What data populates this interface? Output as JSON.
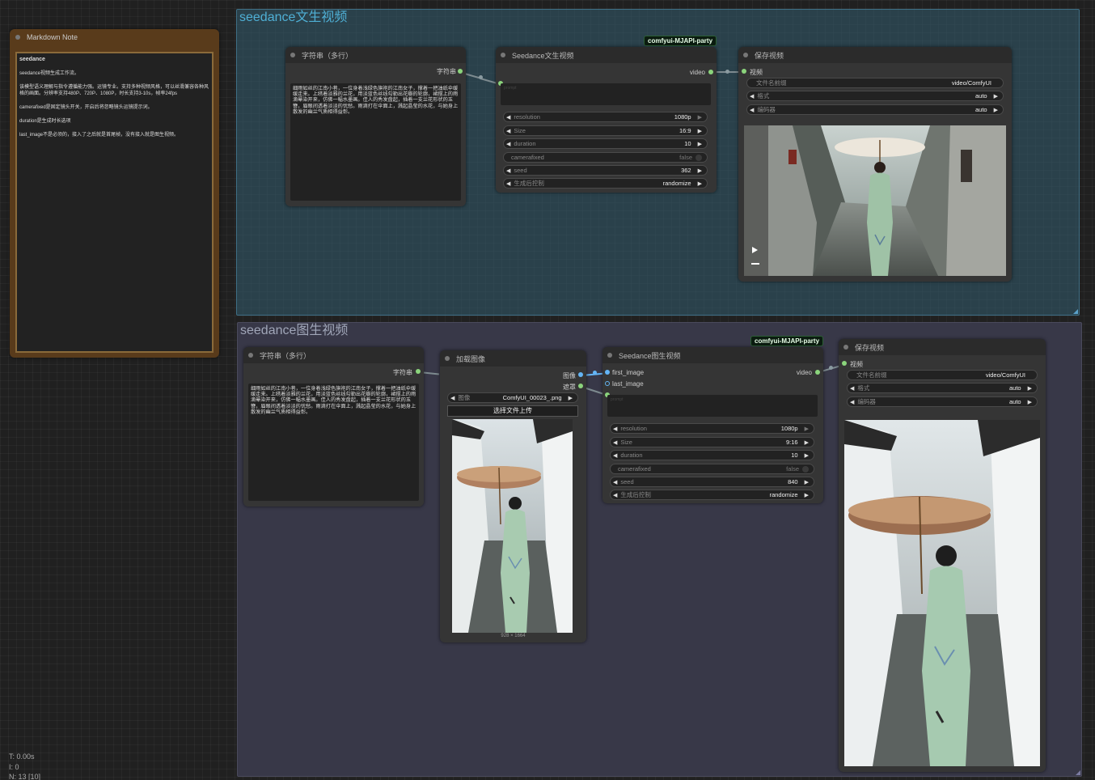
{
  "markdown_note": {
    "title": "Markdown Note",
    "heading": "seedance",
    "paragraphs": [
      "seedance视频生成工作流。",
      "该模型语义理解与指令遵循能力强。运镜专业。支持多种视频风格，可以丝滑兼容各种风格的画面。分辨率支持480P、720P、1080P，时长支持3-10s，帧率24fps",
      "camerafixed是固定镜头开关，开启后将忽略镜头运镜提示词。",
      "duration是生成时长选项",
      "last_image不是必须的，接入了之后就是首尾帧，没有接入就是图生视频。"
    ]
  },
  "groups": {
    "t2v": "seedance文生视频",
    "i2v": "seedance图生视频"
  },
  "badge": "comfyui-MJAPI-party",
  "prompt_text": "细雨如丝的江南小巷，一位身着浅绿色旗袍的江南女子，撑着一把油纸伞缓缓走来。上绣着淡雅的兰花，用淡蓝色丝线勾勒出花瓣的轮廓，裙摆上的雨滴晕染开来，仿佛一幅水墨画。佳人的秀发盘起，插着一支兰花形状的玉簪，眉眼间透着淡淡的忧愁。雨滴打在伞面上，溅起晶莹的水花，与她身上散发的幽兰气质相得益彰。",
  "t2v": {
    "text_node": {
      "title": "字符串（多行）",
      "output": "字符串"
    },
    "seedance_node": {
      "title": "Seedance文生视频",
      "output": "video",
      "prompt_placeholder": "prompt",
      "widgets": [
        {
          "name": "resolution",
          "value": "1080p"
        },
        {
          "name": "Size",
          "value": "16:9"
        },
        {
          "name": "duration",
          "value": "10"
        },
        {
          "name": "camerafixed",
          "value": "false"
        },
        {
          "name": "seed",
          "value": "362"
        },
        {
          "name": "生成后控制",
          "value": "randomize"
        }
      ]
    },
    "save_node": {
      "title": "保存视频",
      "input": "视频",
      "widgets": [
        {
          "name": "文件名前缀",
          "value": "video/ComfyUI"
        },
        {
          "name": "格式",
          "value": "auto"
        },
        {
          "name": "编码器",
          "value": "auto"
        }
      ]
    }
  },
  "i2v": {
    "text_node": {
      "title": "字符串（多行）",
      "output": "字符串"
    },
    "load_image": {
      "title": "加载图像",
      "outputs": [
        "图像",
        "遮罩"
      ],
      "image_label": "图像",
      "image_value": "ComfyUI_00023_.png",
      "upload_button": "选择文件上传",
      "dimensions": "928 × 1664"
    },
    "seedance_node": {
      "title": "Seedance图生视频",
      "inputs": [
        "first_image",
        "last_image"
      ],
      "output": "video",
      "prompt_placeholder": "prompt",
      "widgets": [
        {
          "name": "resolution",
          "value": "1080p"
        },
        {
          "name": "Size",
          "value": "9:16"
        },
        {
          "name": "duration",
          "value": "10"
        },
        {
          "name": "camerafixed",
          "value": "false"
        },
        {
          "name": "seed",
          "value": "840"
        },
        {
          "name": "生成后控制",
          "value": "randomize"
        }
      ]
    },
    "save_node": {
      "title": "保存视频",
      "input": "视频",
      "widgets": [
        {
          "name": "文件名前缀",
          "value": "video/ComfyUI"
        },
        {
          "name": "格式",
          "value": "auto"
        },
        {
          "name": "编码器",
          "value": "auto"
        }
      ]
    }
  },
  "stats": {
    "t": "T: 0.00s",
    "i": "I: 0",
    "n": "N: 13 [10]"
  }
}
